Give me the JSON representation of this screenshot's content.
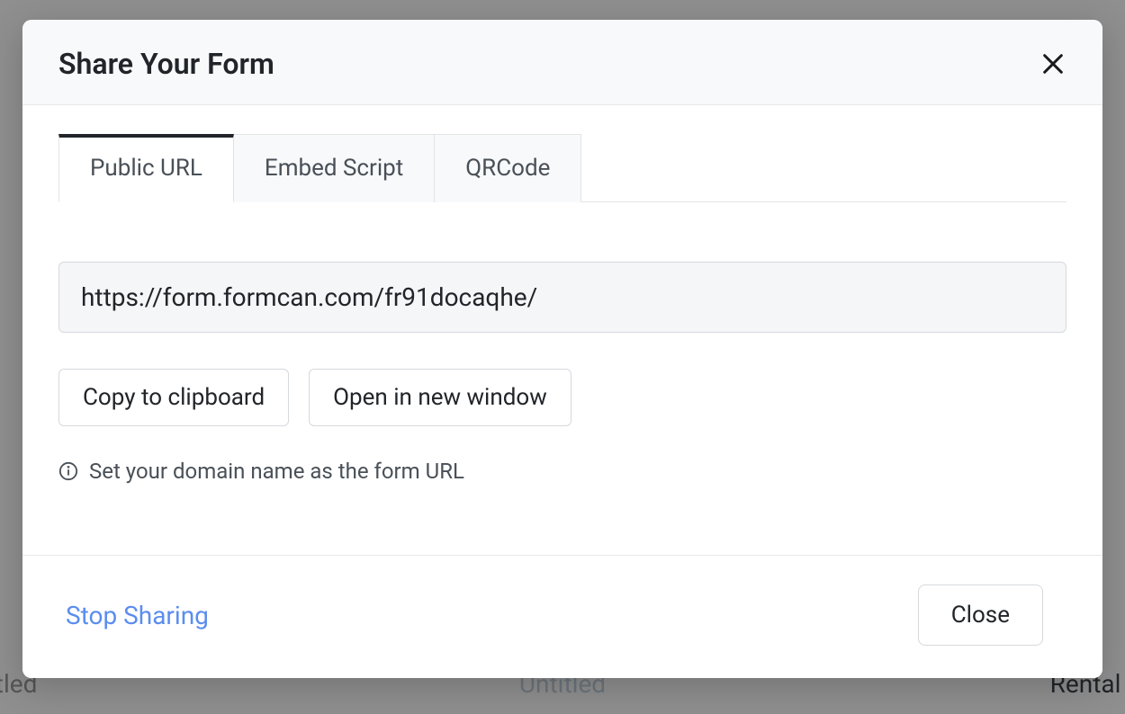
{
  "modal": {
    "title": "Share Your Form",
    "tabs": [
      {
        "label": "Public URL",
        "active": true
      },
      {
        "label": "Embed Script",
        "active": false
      },
      {
        "label": "QRCode",
        "active": false
      }
    ],
    "url_value": "https://form.formcan.com/fr91docaqhe/",
    "copy_label": "Copy to clipboard",
    "open_label": "Open in new window",
    "info_text": "Set your domain name as the form URL",
    "stop_sharing_label": "Stop Sharing",
    "close_label": "Close"
  },
  "background": {
    "left": "itled",
    "center": "Untitled",
    "right": "Rental P"
  }
}
